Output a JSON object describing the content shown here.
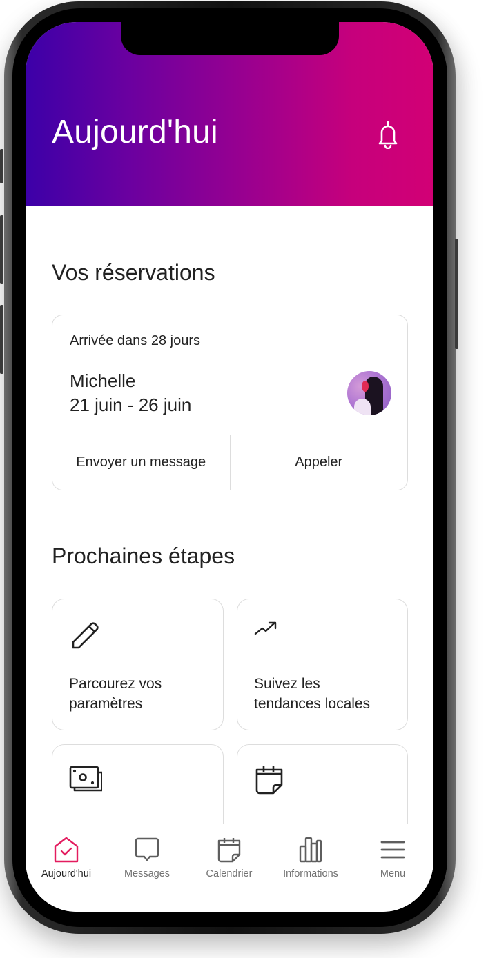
{
  "header": {
    "title": "Aujourd'hui",
    "gradient_start": "#3c00a8",
    "gradient_end": "#d20075"
  },
  "reservations": {
    "section_title": "Vos réservations",
    "card": {
      "arrival_text": "Arrivée dans 28 jours",
      "guest_name": "Michelle",
      "dates": "21 juin - 26 juin",
      "avatar_icon": "guest-avatar"
    },
    "actions": [
      {
        "label": "Envoyer un message"
      },
      {
        "label": "Appeler"
      }
    ]
  },
  "next_steps": {
    "section_title": "Prochaines étapes",
    "tiles": [
      {
        "icon": "pencil-icon",
        "label_line1": "Parcourez vos",
        "label_line2": "paramètres"
      },
      {
        "icon": "trending-up-icon",
        "label_line1": "Suivez les",
        "label_line2": "tendances locales"
      },
      {
        "icon": "money-icon",
        "label_line1": "",
        "label_line2": ""
      },
      {
        "icon": "calendar-icon",
        "label_line1": "",
        "label_line2": ""
      }
    ]
  },
  "bottom_nav": {
    "active_color": "#e31c5f",
    "items": [
      {
        "label": "Aujourd'hui",
        "icon": "home-check-icon",
        "active": true
      },
      {
        "label": "Messages",
        "icon": "chat-bubble-icon",
        "active": false
      },
      {
        "label": "Calendrier",
        "icon": "calendar-icon",
        "active": false
      },
      {
        "label": "Informations",
        "icon": "bar-chart-icon",
        "active": false
      },
      {
        "label": "Menu",
        "icon": "hamburger-menu-icon",
        "active": false
      }
    ]
  }
}
